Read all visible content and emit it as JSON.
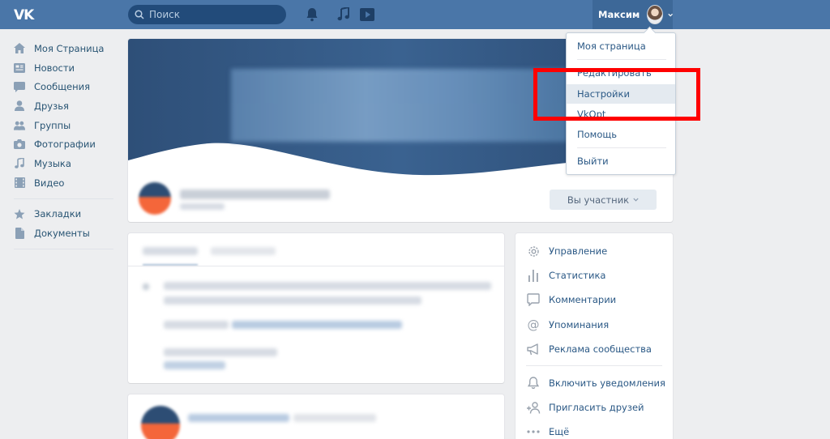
{
  "header": {
    "logo_text": "VK",
    "search_placeholder": "Поиск",
    "user_name": "Максим"
  },
  "left_nav": {
    "items": [
      {
        "label": "Моя Страница",
        "icon": "home-icon"
      },
      {
        "label": "Новости",
        "icon": "news-icon"
      },
      {
        "label": "Сообщения",
        "icon": "messages-icon"
      },
      {
        "label": "Друзья",
        "icon": "friend-icon"
      },
      {
        "label": "Группы",
        "icon": "groups-icon"
      },
      {
        "label": "Фотографии",
        "icon": "camera-icon"
      },
      {
        "label": "Музыка",
        "icon": "music-icon"
      },
      {
        "label": "Видео",
        "icon": "video-icon"
      }
    ],
    "secondary": [
      {
        "label": "Закладки",
        "icon": "star-icon"
      },
      {
        "label": "Документы",
        "icon": "document-icon"
      }
    ]
  },
  "group": {
    "member_button": "Вы участник"
  },
  "dropdown": {
    "items": [
      "Моя страница",
      "Редактировать",
      "Настройки",
      "VkOpt",
      "Помощь",
      "Выйти"
    ],
    "active": "Настройки"
  },
  "right_panel": {
    "items": [
      {
        "label": "Управление",
        "icon": "gear-icon"
      },
      {
        "label": "Статистика",
        "icon": "stats-icon"
      },
      {
        "label": "Комментарии",
        "icon": "comment-icon"
      },
      {
        "label": "Упоминания",
        "icon": "mention-icon"
      },
      {
        "label": "Реклама сообщества",
        "icon": "megaphone-icon"
      },
      {
        "label": "Включить уведомления",
        "icon": "bell-icon"
      },
      {
        "label": "Пригласить друзей",
        "icon": "add-user-icon"
      },
      {
        "label": "Ещё",
        "icon": "more-icon"
      }
    ]
  },
  "colors": {
    "header_bg": "#4a76a8",
    "link": "#2a5885",
    "highlight": "#ff0000"
  }
}
